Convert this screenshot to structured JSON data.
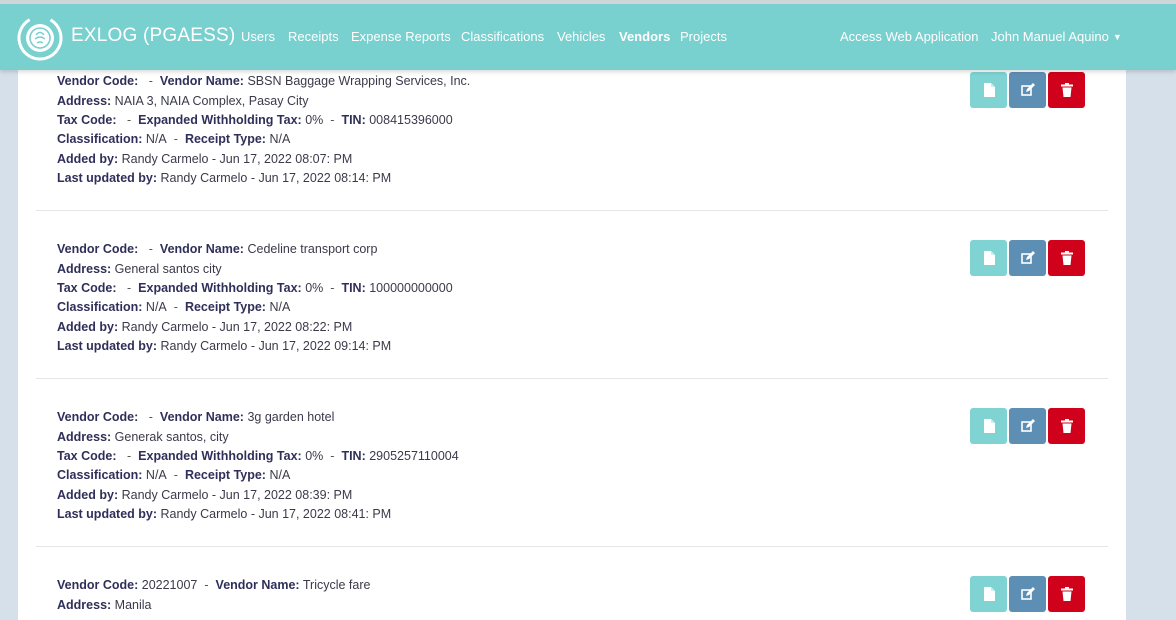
{
  "brand": {
    "title": "EXLOG (PGAESS)"
  },
  "nav": {
    "items": [
      {
        "label": "Users"
      },
      {
        "label": "Receipts"
      },
      {
        "label": "Expense Reports"
      },
      {
        "label": "Classifications"
      },
      {
        "label": "Vehicles"
      },
      {
        "label": "Vendors"
      },
      {
        "label": "Projects"
      }
    ],
    "access_web": "Access Web Application",
    "user": "John Manuel Aquino"
  },
  "labels": {
    "vendor_code": "Vendor Code:",
    "vendor_name": "Vendor Name:",
    "address": "Address:",
    "tax_code": "Tax Code:",
    "ewt": "Expanded Withholding Tax:",
    "tin": "TIN:",
    "classification": "Classification:",
    "receipt_type": "Receipt Type:",
    "added_by": "Added by:",
    "last_updated_by": "Last updated by:",
    "separator": "-"
  },
  "vendors": [
    {
      "code": "",
      "name": "SBSN Baggage Wrapping Services, Inc.",
      "address": "NAIA 3, NAIA Complex, Pasay City",
      "tax_code": "",
      "ewt": "0%",
      "tin": "008415396000",
      "classification": "N/A",
      "receipt_type": "N/A",
      "added_by": "Randy Carmelo - Jun 17, 2022 08:07: PM",
      "updated_by": "Randy Carmelo - Jun 17, 2022 08:14: PM"
    },
    {
      "code": "",
      "name": "Cedeline transport corp",
      "address": "General santos city",
      "tax_code": "",
      "ewt": "0%",
      "tin": "100000000000",
      "classification": "N/A",
      "receipt_type": "N/A",
      "added_by": "Randy Carmelo - Jun 17, 2022 08:22: PM",
      "updated_by": "Randy Carmelo - Jun 17, 2022 09:14: PM"
    },
    {
      "code": "",
      "name": "3g garden hotel",
      "address": "Generak santos, city",
      "tax_code": "",
      "ewt": "0%",
      "tin": "2905257110004",
      "classification": "N/A",
      "receipt_type": "N/A",
      "added_by": "Randy Carmelo - Jun 17, 2022 08:39: PM",
      "updated_by": "Randy Carmelo - Jun 17, 2022 08:41: PM"
    },
    {
      "code": "20221007",
      "name": "Tricycle fare",
      "address": "Manila"
    }
  ],
  "icons": {
    "view": "file-icon",
    "edit": "edit-icon",
    "delete": "trash-icon"
  },
  "colors": {
    "navbar": "#78d0cf",
    "view_button": "#7fd3d3",
    "edit_button": "#5d8fb5",
    "delete_button": "#d0021b"
  }
}
